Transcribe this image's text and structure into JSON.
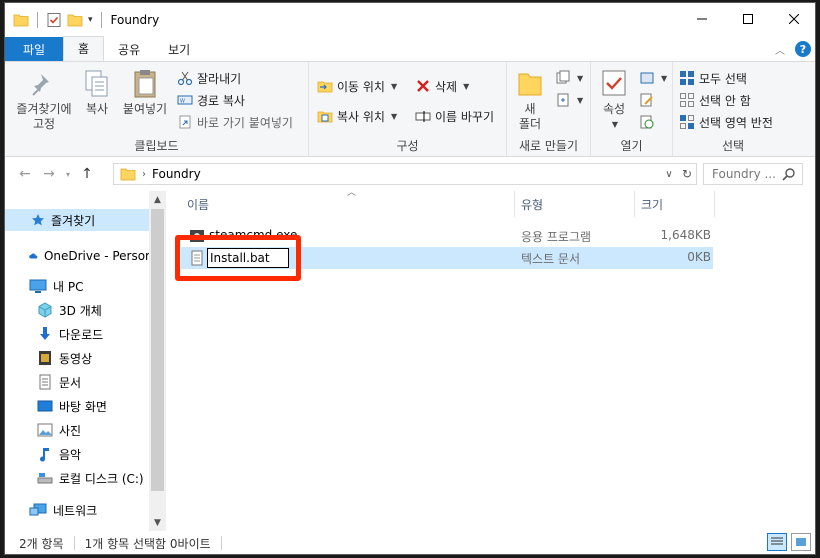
{
  "window": {
    "title": "Foundry"
  },
  "tabs": [
    {
      "label": "파일"
    },
    {
      "label": "홈"
    },
    {
      "label": "공유"
    },
    {
      "label": "보기"
    }
  ],
  "ribbon": {
    "clipboard": {
      "label": "클립보드",
      "pin": "즐겨찾기에\n고정",
      "copy": "복사",
      "paste": "붙여넣기",
      "cut": "잘라내기",
      "copy_path": "경로 복사",
      "paste_shortcut": "바로 가기 붙여넣기"
    },
    "organize": {
      "label": "구성",
      "move_to": "이동 위치",
      "copy_to": "복사 위치",
      "delete": "삭제",
      "rename": "이름 바꾸기"
    },
    "new": {
      "label": "새로 만들기",
      "new_folder": "새\n폴더"
    },
    "open": {
      "label": "열기",
      "properties": "속성"
    },
    "select": {
      "label": "선택",
      "select_all": "모두 선택",
      "select_none": "선택 안 함",
      "invert": "선택 영역 반전"
    }
  },
  "address": {
    "path": "Foundry",
    "search_placeholder": "Foundry ..."
  },
  "navpane": {
    "items": [
      {
        "label": "즐겨찾기",
        "icon": "star-icon"
      },
      {
        "label": "OneDrive - Persor",
        "icon": "cloud-icon"
      },
      {
        "label": "내 PC",
        "icon": "pc-icon"
      },
      {
        "label": "3D 개체",
        "icon": "cube-icon"
      },
      {
        "label": "다운로드",
        "icon": "download-icon"
      },
      {
        "label": "동영상",
        "icon": "video-icon"
      },
      {
        "label": "문서",
        "icon": "document-icon"
      },
      {
        "label": "바탕 화면",
        "icon": "desktop-icon"
      },
      {
        "label": "사진",
        "icon": "picture-icon"
      },
      {
        "label": "음악",
        "icon": "music-icon"
      },
      {
        "label": "로컬 디스크 (C:)",
        "icon": "drive-icon"
      },
      {
        "label": "네트워크",
        "icon": "network-icon"
      }
    ]
  },
  "columns": {
    "name": "이름",
    "type": "유형",
    "size": "크기"
  },
  "files": [
    {
      "name": "steamcmd.exe",
      "type": "응용 프로그램",
      "size": "1,648KB"
    },
    {
      "name": "Install.bat",
      "type": "텍스트 문서",
      "size": "0KB"
    }
  ],
  "status": {
    "count": "2개 항목",
    "selected": "1개 항목 선택함 0바이트"
  },
  "colors": {
    "accent": "#1979ca",
    "selection": "#cce8ff",
    "highlight": "#ff2a00"
  }
}
